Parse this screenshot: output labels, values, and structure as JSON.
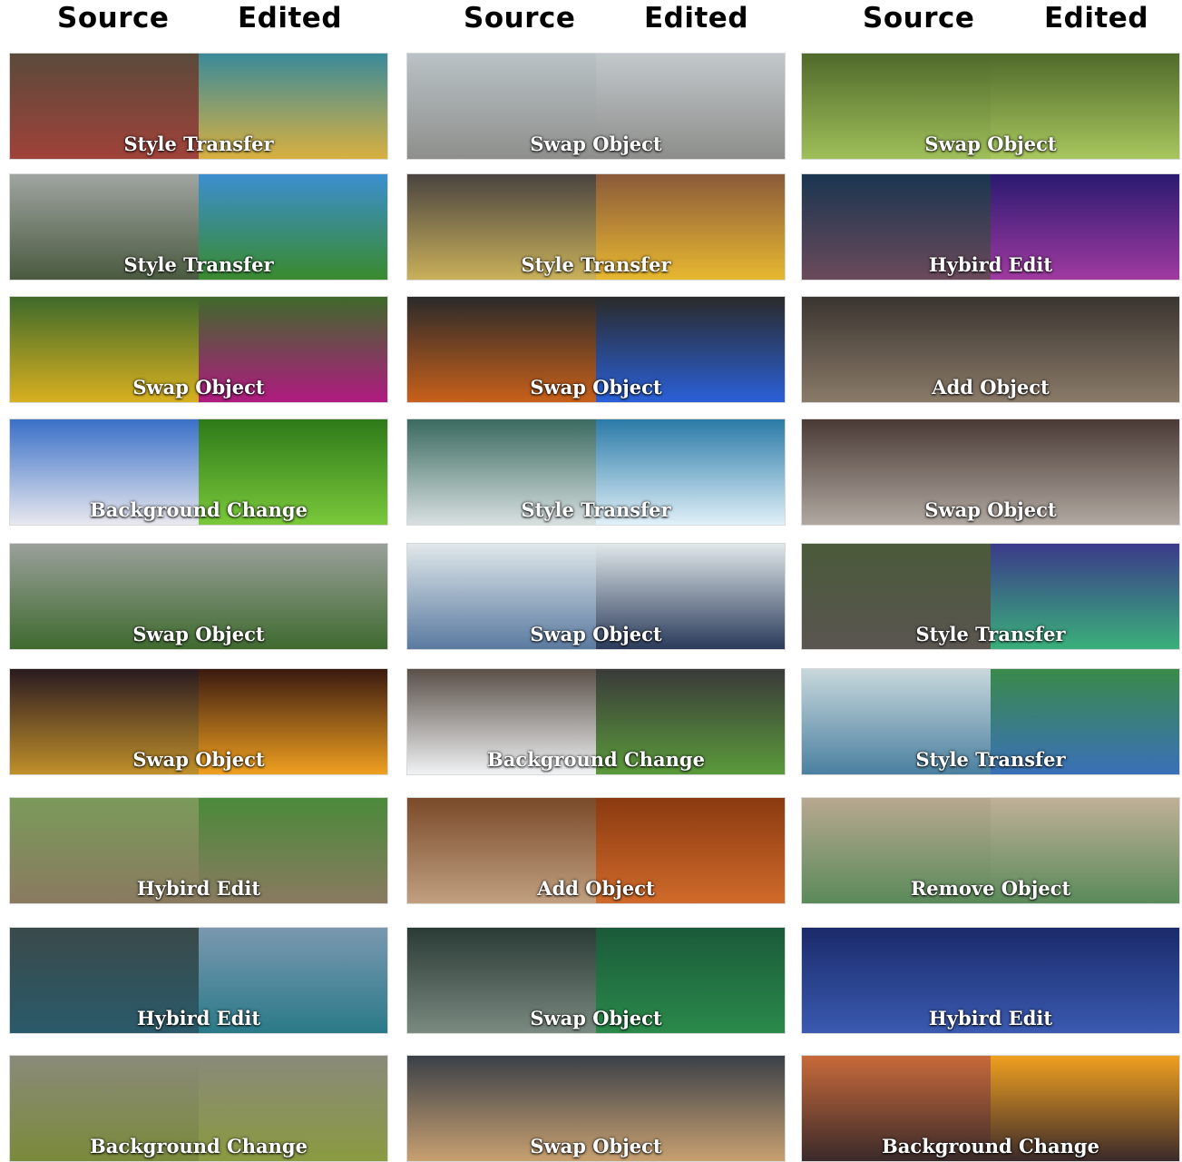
{
  "headers": {
    "col1_source": "Source",
    "col1_edited": "Edited",
    "col2_source": "Source",
    "col2_edited": "Edited",
    "col3_source": "Source",
    "col3_edited": "Edited"
  },
  "examples": [
    {
      "label": "Style Transfer",
      "src": [
        "#5a4a3a",
        "#a0423a"
      ],
      "edt": [
        "#3a8a9a",
        "#d8b040"
      ]
    },
    {
      "label": "Swap Object",
      "src": [
        "#b9c2c6",
        "#8e8f8c"
      ],
      "edt": [
        "#c2c8cb",
        "#8d8e8b"
      ]
    },
    {
      "label": "Swap Object",
      "src": [
        "#4f6a2a",
        "#9fbf5a"
      ],
      "edt": [
        "#4f6a2a",
        "#a8c75e"
      ]
    },
    {
      "label": "Style Transfer",
      "src": [
        "#9fa4a0",
        "#4a5a40"
      ],
      "edt": [
        "#3b8fcf",
        "#3a8a2e"
      ]
    },
    {
      "label": "Style Transfer",
      "src": [
        "#4a4440",
        "#c9b05a"
      ],
      "edt": [
        "#8a5a3a",
        "#e8b830"
      ]
    },
    {
      "label": "Hybird Edit",
      "src": [
        "#1a3550",
        "#6a4a5a"
      ],
      "edt": [
        "#2a1a70",
        "#a03aa0"
      ]
    },
    {
      "label": "Swap Object",
      "src": [
        "#3f6a2a",
        "#d8b020"
      ],
      "edt": [
        "#3f6a2a",
        "#b01a80"
      ]
    },
    {
      "label": "Swap Object",
      "src": [
        "#2a2a2a",
        "#c8601a"
      ],
      "edt": [
        "#2a2a2a",
        "#2a60d8"
      ]
    },
    {
      "label": "Add Object",
      "src": [
        "#3a3530",
        "#8a7a68"
      ],
      "edt": [
        "#3a3530",
        "#8a7a68"
      ]
    },
    {
      "label": "Background Change",
      "src": [
        "#3a70c8",
        "#e8e8ee"
      ],
      "edt": [
        "#2e7a1a",
        "#7ac83a"
      ]
    },
    {
      "label": "Style Transfer",
      "src": [
        "#3a6a60",
        "#d8e0e0"
      ],
      "edt": [
        "#2a7aa8",
        "#e0f0f8"
      ]
    },
    {
      "label": "Swap Object",
      "src": [
        "#4a3a35",
        "#b0a8a0"
      ],
      "edt": [
        "#4a3a35",
        "#b0a8a0"
      ]
    },
    {
      "label": "Swap Object",
      "src": [
        "#9aa09a",
        "#3f6a2f"
      ],
      "edt": [
        "#9aa09a",
        "#3f6a2f"
      ]
    },
    {
      "label": "Swap Object",
      "src": [
        "#e0e8ea",
        "#5a7aa0"
      ],
      "edt": [
        "#e0e8ea",
        "#2a3a5a"
      ]
    },
    {
      "label": "Style Transfer",
      "src": [
        "#4a5a3a",
        "#5a5550"
      ],
      "edt": [
        "#3a3a8a",
        "#3ab07a"
      ]
    },
    {
      "label": "Swap Object",
      "src": [
        "#2a1a20",
        "#c0902a"
      ],
      "edt": [
        "#3a1a10",
        "#f0a020"
      ]
    },
    {
      "label": "Background Change",
      "src": [
        "#5a5048",
        "#f0f2f4"
      ],
      "edt": [
        "#3a3a3a",
        "#5a9a3a"
      ]
    },
    {
      "label": "Style Transfer",
      "src": [
        "#c8d8dc",
        "#4a80a0"
      ],
      "edt": [
        "#3a8a4a",
        "#3a70b8"
      ]
    },
    {
      "label": "Hybird Edit",
      "src": [
        "#7a9a5a",
        "#8a7a60"
      ],
      "edt": [
        "#4a8a3a",
        "#8a7a60"
      ]
    },
    {
      "label": "Add Object",
      "src": [
        "#7a4a2a",
        "#c0a080"
      ],
      "edt": [
        "#8a3a10",
        "#d06a2a"
      ]
    },
    {
      "label": "Remove Object",
      "src": [
        "#b8a890",
        "#5a8a5a"
      ],
      "edt": [
        "#c0b098",
        "#5a8a5a"
      ]
    },
    {
      "label": "Hybird Edit",
      "src": [
        "#3a4a4a",
        "#2a5a6a"
      ],
      "edt": [
        "#7a98b0",
        "#2a7a88"
      ]
    },
    {
      "label": "Swap Object",
      "src": [
        "#2a3a35",
        "#7a8a80"
      ],
      "edt": [
        "#1a5a3a",
        "#2a8a4a"
      ]
    },
    {
      "label": "Hybird Edit",
      "src": [
        "#1a2a6a",
        "#3a5ab0"
      ],
      "edt": [
        "#1a2a6a",
        "#3a5ab0"
      ]
    },
    {
      "label": "Background Change",
      "src": [
        "#8a8a7a",
        "#7a8a3a"
      ],
      "edt": [
        "#8a8a7a",
        "#8a9a40"
      ]
    },
    {
      "label": "Swap Object",
      "src": [
        "#3a4048",
        "#c8a070"
      ],
      "edt": [
        "#3a4048",
        "#c8a070"
      ]
    },
    {
      "label": "Background Change",
      "src": [
        "#c86a3a",
        "#3a2a2a"
      ],
      "edt": [
        "#f0a020",
        "#3a2a2a"
      ]
    }
  ]
}
